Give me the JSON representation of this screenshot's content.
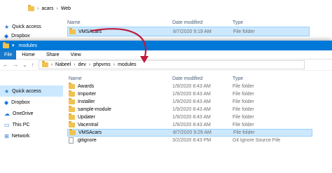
{
  "back_window": {
    "path": [
      "acars",
      "Web"
    ],
    "columns": {
      "name": "Name",
      "date": "Date modified",
      "type": "Type"
    },
    "row": {
      "name": "VMSAcars",
      "date": "8/7/2020 9:19 AM",
      "type": "File folder"
    },
    "nav": [
      "Quick access",
      "Dropbox"
    ]
  },
  "front_window": {
    "title": "modules",
    "ribbon_tabs": [
      "File",
      "Home",
      "Share",
      "View"
    ],
    "path": [
      "Nabeel",
      "dev",
      "phpvms",
      "modules"
    ],
    "nav": [
      {
        "label": "Quick access",
        "icon": "star-icon",
        "active": true
      },
      {
        "label": "Dropbox",
        "icon": "dropbox-icon",
        "active": false
      },
      {
        "label": "OneDrive",
        "icon": "cloud-icon",
        "active": false
      },
      {
        "label": "This PC",
        "icon": "pc-icon",
        "active": false
      },
      {
        "label": "Network",
        "icon": "network-icon",
        "active": false
      }
    ],
    "columns": {
      "name": "Name",
      "date": "Date modified",
      "type": "Type"
    },
    "rows": [
      {
        "name": "Awards",
        "date": "1/9/2020 8:43 AM",
        "type": "File folder",
        "icon": "folder-icon"
      },
      {
        "name": "Importer",
        "date": "1/9/2020 8:43 AM",
        "type": "File folder",
        "icon": "folder-icon"
      },
      {
        "name": "Installer",
        "date": "1/9/2020 8:43 AM",
        "type": "File folder",
        "icon": "folder-icon"
      },
      {
        "name": "sample-module",
        "date": "1/9/2020 8:43 AM",
        "type": "File folder",
        "icon": "folder-icon"
      },
      {
        "name": "Updater",
        "date": "1/9/2020 8:43 AM",
        "type": "File folder",
        "icon": "folder-icon"
      },
      {
        "name": "Vacentral",
        "date": "1/9/2020 8:43 AM",
        "type": "File folder",
        "icon": "folder-icon"
      },
      {
        "name": "VMSAcars",
        "date": "8/7/2020 9:29 AM",
        "type": "File folder",
        "icon": "folder-icon",
        "selected": true
      },
      {
        "name": ".gitignore",
        "date": "3/2/2020 8:43 PM",
        "type": "Git Ignore Source File",
        "icon": "file-icon"
      }
    ]
  },
  "colors": {
    "accent": "#0078d7",
    "selection": "#cce8ff",
    "arrow": "#c0183a"
  }
}
